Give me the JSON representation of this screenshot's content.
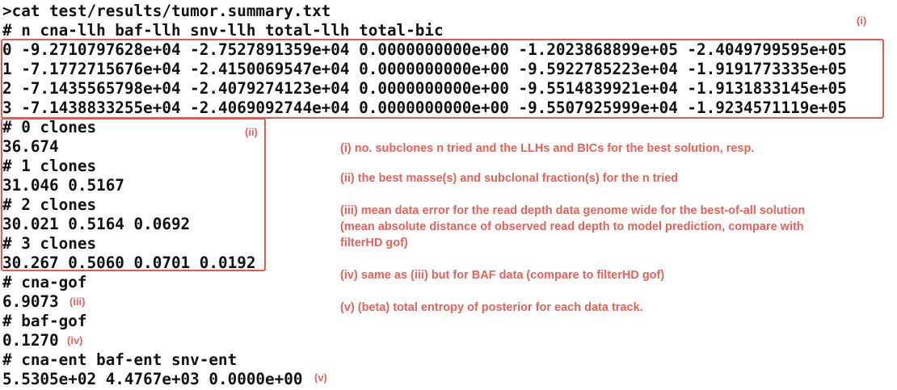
{
  "terminal": {
    "command": ">cat test/results/tumor.summary.txt",
    "header": "# n cna-llh baf-llh snv-llh total-llh total-bic",
    "rows": [
      "0 -9.2710797628e+04 -2.7527891359e+04 0.0000000000e+00 -1.2023868899e+05 -2.4049799595e+05",
      "1 -7.1772715676e+04 -2.4150069547e+04 0.0000000000e+00 -9.5922785223e+04 -1.9191773335e+05",
      "2 -7.1435565798e+04 -2.4079274123e+04 0.0000000000e+00 -9.5514839921e+04 -1.9131833145e+05",
      "3 -7.1438833255e+04 -2.4069092744e+04 0.0000000000e+00 -9.5507925999e+04 -1.9234571119e+05"
    ],
    "clones": [
      "# 0 clones",
      "36.674",
      "# 1 clones",
      "31.046 0.5167",
      "# 2 clones",
      "30.021 0.5164 0.0692",
      "# 3 clones",
      "30.267 0.5060 0.0701 0.0192"
    ],
    "cna_gof_header": "# cna-gof",
    "cna_gof_value": "6.9073",
    "baf_gof_header": "# baf-gof",
    "baf_gof_value": "0.1270",
    "ent_header": "# cna-ent baf-ent snv-ent",
    "ent_value": "5.5305e+02 4.4767e+03 0.0000e+00"
  },
  "annotations": {
    "tag_i": "(i)",
    "tag_ii": "(ii)",
    "tag_iii": "(iii)",
    "tag_iv": "(iv)",
    "tag_v": "(v)",
    "note_i": "(i) no. subclones n tried and the LLHs and BICs for the best solution, resp.",
    "note_ii": "(ii) the best masse(s) and subclonal fraction(s) for the n tried",
    "note_iii_1": "(iii) mean data error for the read depth data genome wide for the best-of-all solution",
    "note_iii_2": "(mean absolute distance of observed read depth to model prediction, compare with",
    "note_iii_3": "filterHD gof)",
    "note_iv": "(iv) same as (iii) but for BAF data (compare to filterHD gof)",
    "note_v": "(v) (beta) total entropy of posterior for each data track."
  },
  "colors": {
    "annotation": "#ec5f55",
    "text": "#111111",
    "background": "#ffffff"
  }
}
